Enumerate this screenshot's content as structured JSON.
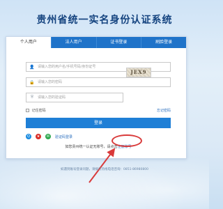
{
  "site": {
    "title": "贵州省统一实名身份认证系统"
  },
  "tabs": [
    {
      "label": "个人用户",
      "active": true
    },
    {
      "label": "法人用户",
      "active": false
    },
    {
      "label": "证书登录",
      "active": false
    },
    {
      "label": "刷脸登录",
      "active": false
    }
  ],
  "form": {
    "username_placeholder": "请输入您的用户名/手机号码/身份证号",
    "password_placeholder": "请输入您的密码",
    "captcha_placeholder": "请输入您的验证码",
    "captcha_text": "JEX9",
    "remember_label": "记住密码",
    "forgot_link": "忘记密码",
    "login_button": "登录",
    "sms_login_link": "验证码登录",
    "register_prefix": "如您贵州统一认证无账号，请点击",
    "register_link": "注册账号"
  },
  "footer": {
    "text": "如遇到账号登录问题，请拨打热线电话咨询：0851-86980800"
  },
  "colors": {
    "primary": "#1f7fd6",
    "title": "#14437f",
    "annotation": "#d93a3a"
  }
}
